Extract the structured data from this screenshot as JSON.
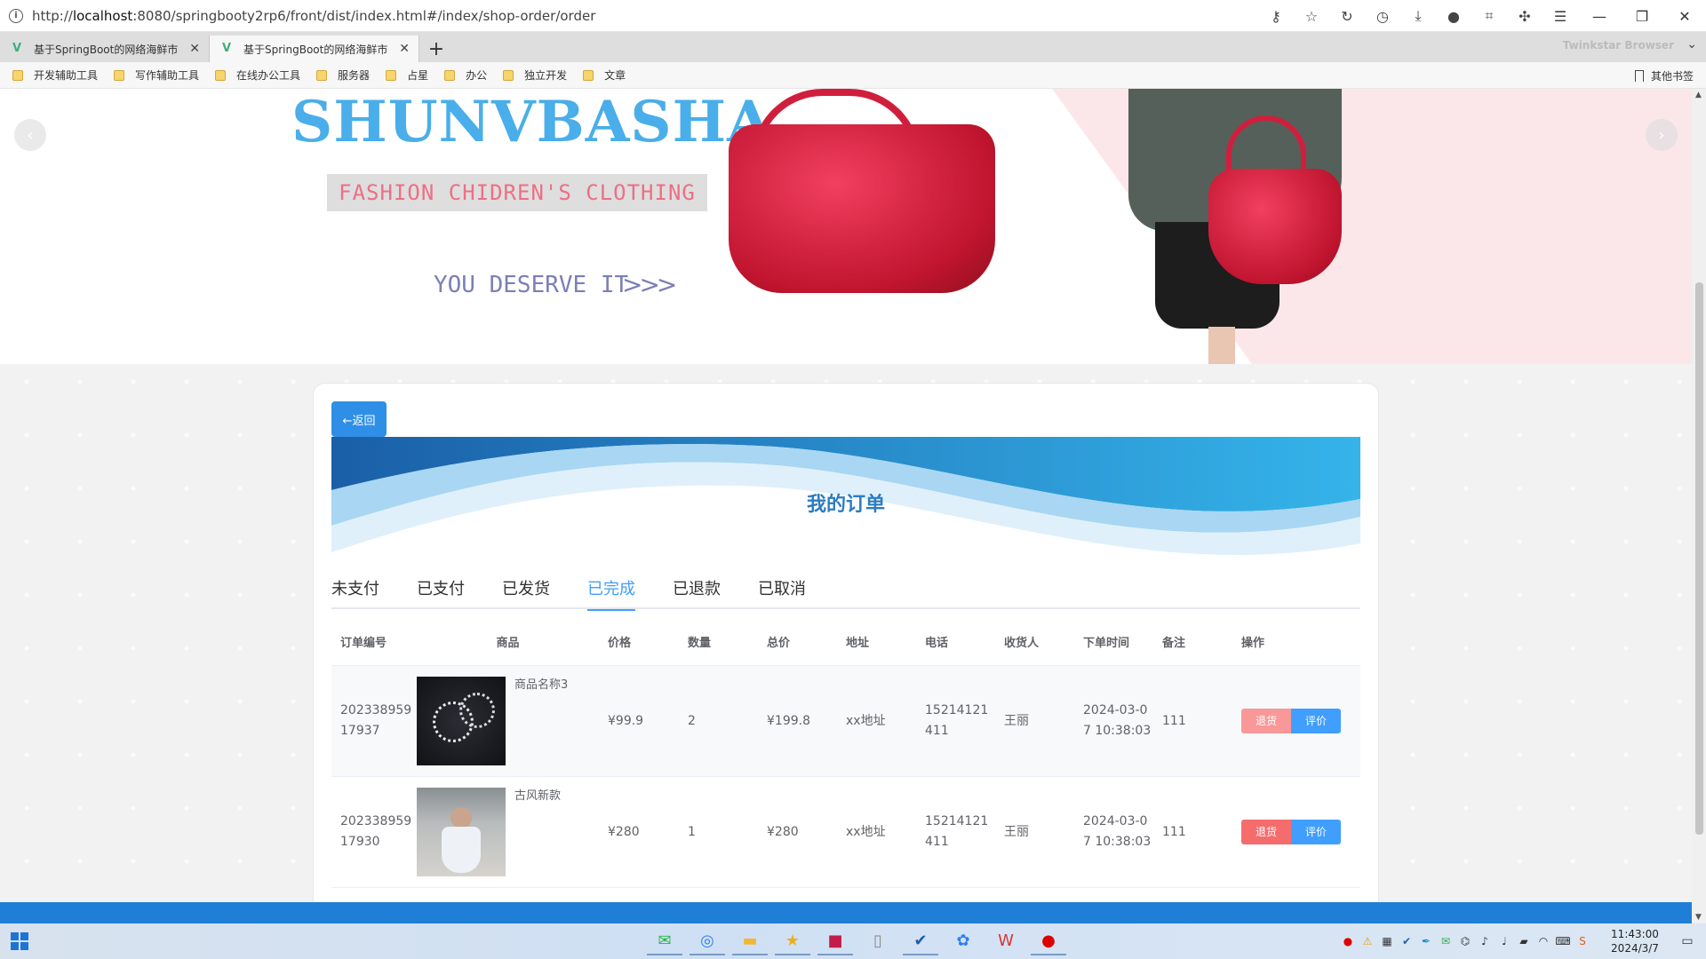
{
  "browser": {
    "url_prefix": "http://",
    "url_host": "localhost",
    "url_rest": ":8080/springbooty2rp6/front/dist/index.html#/index/shop-order/order",
    "tabs": [
      {
        "title": "基于SpringBoot的网络海鲜市",
        "active": false
      },
      {
        "title": "基于SpringBoot的网络海鲜市",
        "active": true
      }
    ],
    "brand": "Twinkstar Browser",
    "bookmarks": [
      "开发辅助工具",
      "写作辅助工具",
      "在线办公工具",
      "服务器",
      "占星",
      "办公",
      "独立开发",
      "文章"
    ],
    "other_bookmarks": "其他书签"
  },
  "banner": {
    "logo": "SHUNVBASHA",
    "subtitle": "FASHION CHIDREN'S CLOTHING",
    "tagline": "YOU DESERVE IT",
    "arrows": ">>>"
  },
  "page": {
    "back_label": "←返回",
    "title": "我的订单",
    "tabs": [
      "未支付",
      "已支付",
      "已发货",
      "已完成",
      "已退款",
      "已取消"
    ],
    "active_tab": "已完成",
    "columns": [
      "订单编号",
      "商品",
      "价格",
      "数量",
      "总价",
      "地址",
      "电话",
      "收货人",
      "下单时间",
      "备注",
      "操作"
    ],
    "rows": [
      {
        "order_id": "20233895917937",
        "goods_name": "商品名称3",
        "price": "¥99.9",
        "qty": "2",
        "total": "¥199.8",
        "address": "xx地址",
        "phone": "15214121411",
        "receiver": "王丽",
        "time": "2024-03-07 10:38:03",
        "note": "111",
        "refund": "退货",
        "rate": "评价"
      },
      {
        "order_id": "20233895917930",
        "goods_name": "古风新款",
        "price": "¥280",
        "qty": "1",
        "total": "¥280",
        "address": "xx地址",
        "phone": "15214121411",
        "receiver": "王丽",
        "time": "2024-03-07 10:38:03",
        "note": "111",
        "refund": "退货",
        "rate": "评价"
      }
    ]
  },
  "taskbar": {
    "time": "11:43:00",
    "date": "2024/3/7"
  },
  "colors": {
    "primary": "#409eff",
    "danger": "#f56c6c",
    "title": "#2c7cc0",
    "banner_logo": "#49aee9"
  }
}
